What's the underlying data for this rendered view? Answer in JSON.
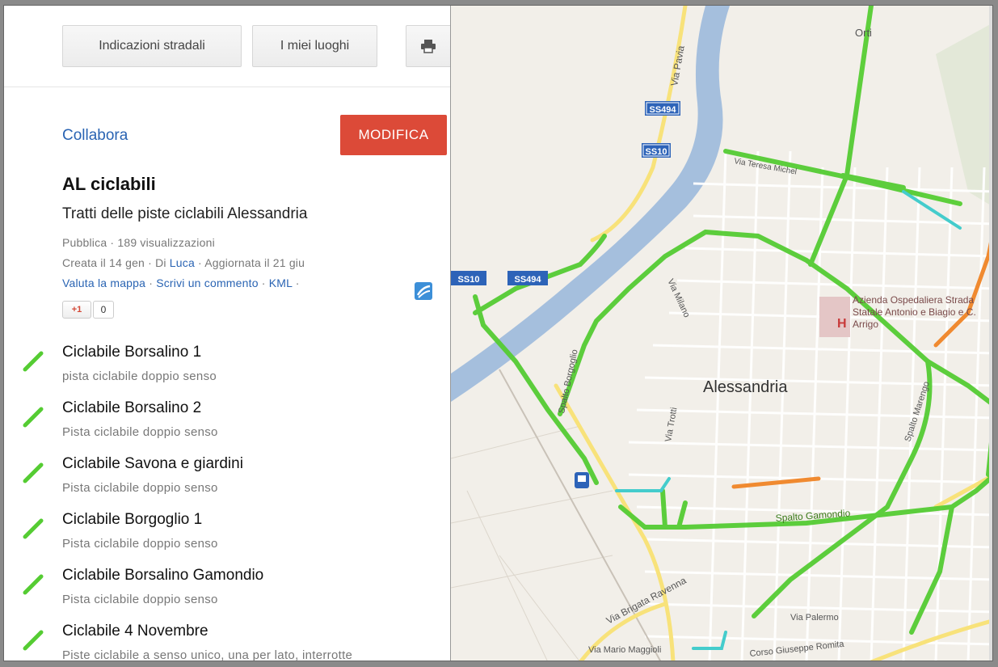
{
  "toolbar": {
    "directions_label": "Indicazioni stradali",
    "my_places_label": "I miei luoghi",
    "print_icon": "printer-icon"
  },
  "panel": {
    "collaborate_link": "Collabora",
    "edit_button": "MODIFICA",
    "title": "AL ciclabili",
    "description": "Tratti delle piste ciclabili Alessandria",
    "meta_line1": "Pubblica · 189 visualizzazioni",
    "created_prefix": "Creata il 14 gen · Di ",
    "author": "Luca",
    "updated_suffix": " · Aggiornata il 21 giu",
    "rate_link": "Valuta la mappa",
    "comment_link": "Scrivi un commento",
    "kml_link": "KML",
    "sep": " · ",
    "gplus_label": "+1",
    "gplus_count": "0"
  },
  "routes": [
    {
      "name": "Ciclabile Borsalino 1",
      "desc": "pista ciclabile doppio senso"
    },
    {
      "name": "Ciclabile Borsalino 2",
      "desc": "Pista ciclabile doppio senso"
    },
    {
      "name": "Ciclabile Savona e giardini",
      "desc": "Pista ciclabile doppio senso"
    },
    {
      "name": "Ciclabile Borgoglio 1",
      "desc": "Pista ciclabile doppio senso"
    },
    {
      "name": "Ciclabile Borsalino Gamondio",
      "desc": "Pista ciclabile doppio senso"
    },
    {
      "name": "Ciclabile 4 Novembre",
      "desc": "Piste ciclabile a senso unico, una per lato, interrotte"
    }
  ],
  "map": {
    "city_label": "Alessandria",
    "road_labels": {
      "via_pavia": "Via Pavia",
      "ss494": "SS494",
      "ss10_a": "SS10",
      "ss10_b": "SS10",
      "ss494_b": "SS494",
      "via_teresa_michel": "Via Teresa Michel",
      "via_milano": "Via Milano",
      "spalto_borgoglio": "Spalto Borgoglio",
      "via_trotti": "Via Trotti",
      "spalto_marengo": "Spalto Marengo",
      "spalto_gamondio": "Spalto Gamondio",
      "via_brigata_ravenna": "Via Brigata Ravenna",
      "via_palermo": "Via Palermo",
      "corso_romita": "Corso Giuseppe Romita",
      "via_mario_maggioli": "Via Mario Maggioli",
      "orti": "Orti"
    },
    "hospital_letter": "H",
    "hospital_name": "Azienda Ospedaliera Strada Statale Antonio e Biagio e C. Arrigo",
    "colors": {
      "land": "#f2efe9",
      "river": "#a5bfdd",
      "bike_green": "#55cc33",
      "bike_cyan": "#44cccc",
      "bike_orange": "#f08a30",
      "yellow_road": "#f8e27a"
    }
  }
}
